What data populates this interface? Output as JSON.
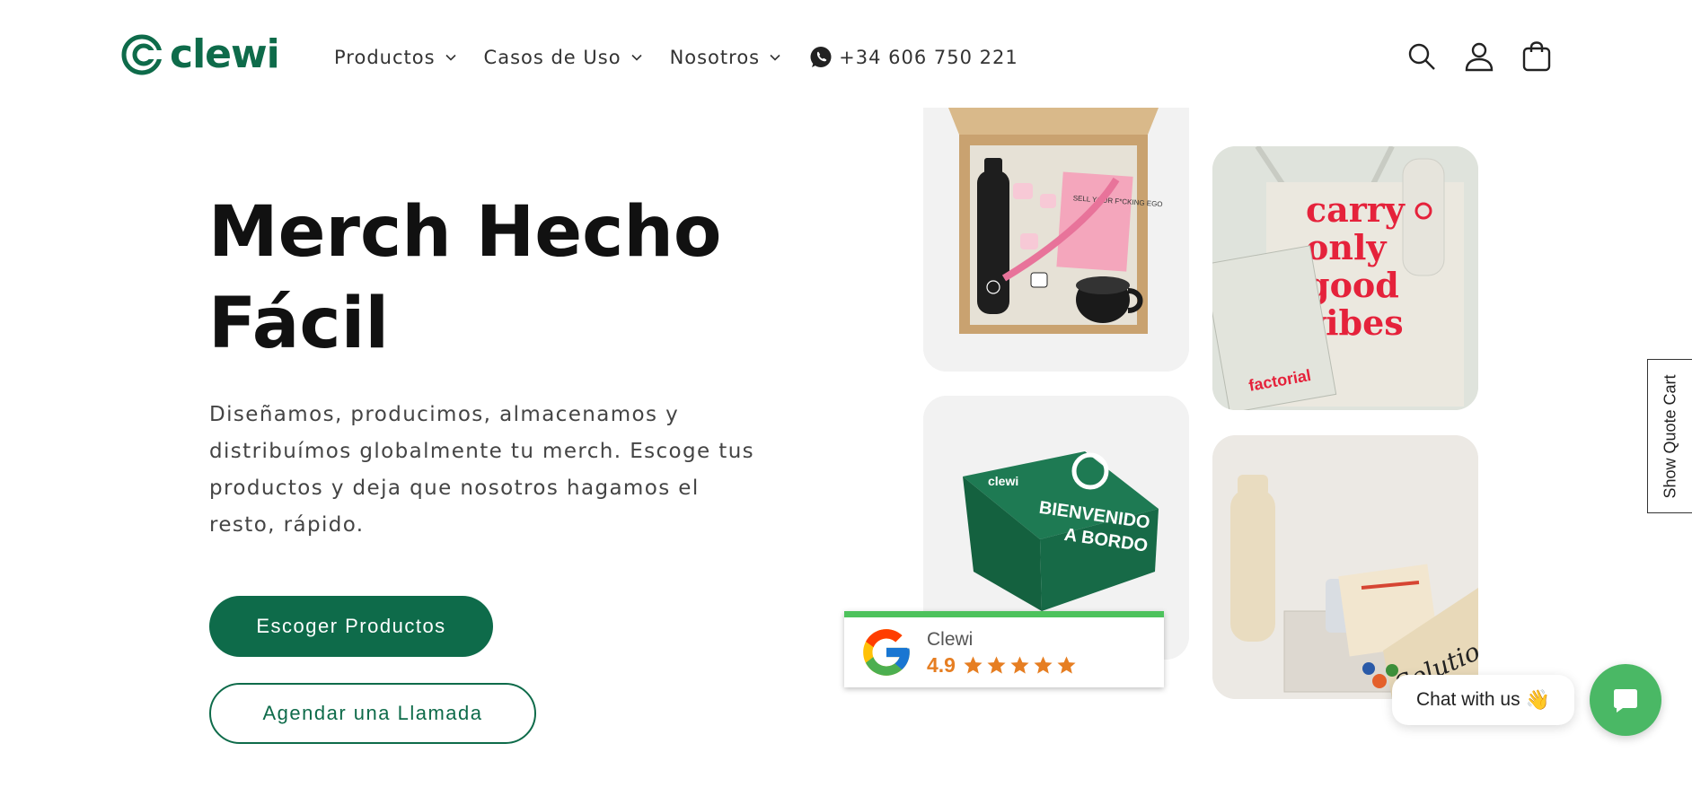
{
  "brand": {
    "name": "clewi",
    "color": "#0e6b4a"
  },
  "nav": {
    "items": [
      {
        "label": "Productos",
        "icon": "chevron-down-icon"
      },
      {
        "label": "Casos de Uso",
        "icon": "chevron-down-icon"
      },
      {
        "label": "Nosotros",
        "icon": "chevron-down-icon"
      }
    ],
    "phone": "+34 606 750 221",
    "phone_icon": "whatsapp-icon"
  },
  "header_icons": [
    "search-icon",
    "account-icon",
    "cart-icon"
  ],
  "hero": {
    "title_line1": "Merch Hecho",
    "title_line2": "Fácil",
    "description": "Diseñamos, producimos, almacenamos y distribuímos globalmente tu merch. Escoge tus productos y deja que nosotros hagamos el resto, rápido.",
    "primary_button": "Escoger Productos",
    "secondary_button": "Agendar una Llamada"
  },
  "tiles": {
    "box_text": "SELL YOUR F*CKING EGO",
    "tote_line1": "carry",
    "tote_line2": "only",
    "tote_line3": "good",
    "tote_line4": "vibes",
    "notebook_brand": "factorial",
    "welcome_box_brand": "clewi",
    "welcome_box_line1": "BIENVENIDO",
    "welcome_box_line2": "A BORDO",
    "solutio_brand": "Solutio"
  },
  "review": {
    "name": "Clewi",
    "score": "4.9",
    "stars": 5,
    "accent": "#4dc25c",
    "score_color": "#e67e22"
  },
  "quote_cart": {
    "label": "Show Quote Cart"
  },
  "chat": {
    "label": "Chat with us",
    "emoji": "👋",
    "button_color": "#4ab865"
  }
}
